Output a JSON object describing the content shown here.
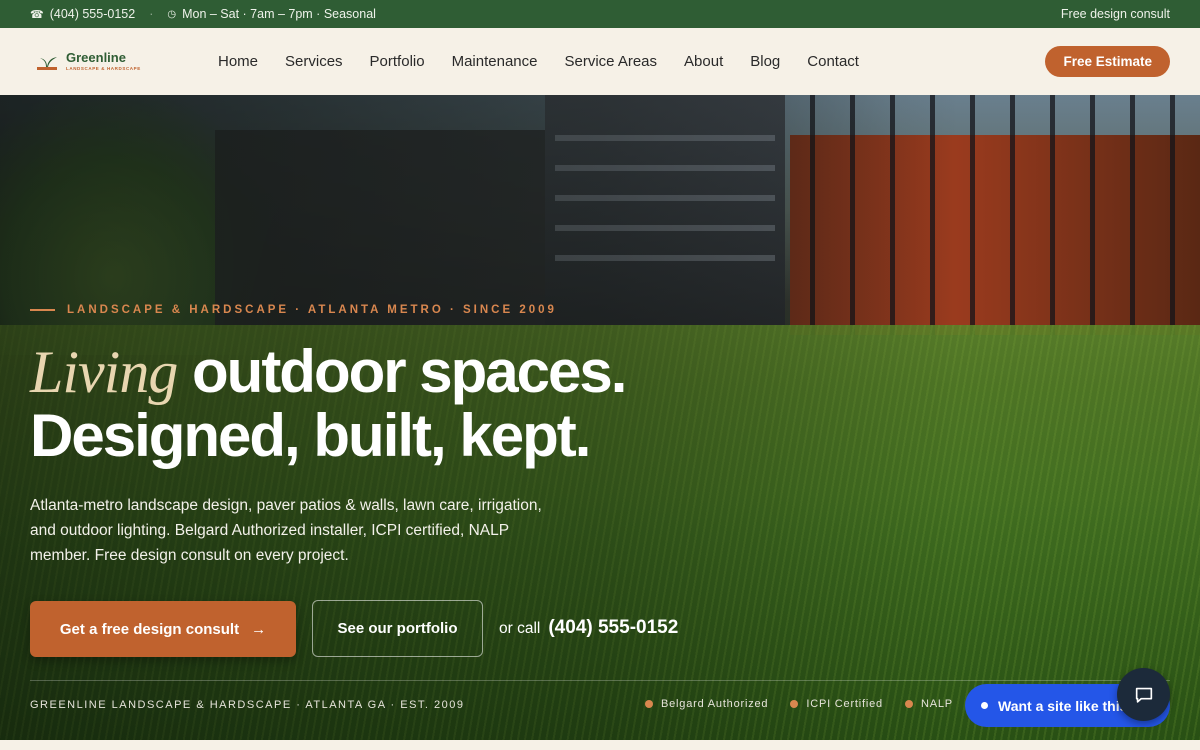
{
  "topbar": {
    "phone": "(404) 555-0152",
    "hours": "Mon – Sat · 7am – 7pm · Seasonal",
    "separator": "·",
    "right_text": "Free design consult",
    "phone_icon": "☎",
    "clock_icon": "◷"
  },
  "brand": {
    "name": "Greenline",
    "tagline": "LANDSCAPE & HARDSCAPE",
    "colors": {
      "green": "#2f5d34",
      "accent": "#c0622e",
      "cream": "#f6f1e7"
    }
  },
  "nav": {
    "items": [
      "Home",
      "Services",
      "Portfolio",
      "Maintenance",
      "Service Areas",
      "About",
      "Blog",
      "Contact"
    ],
    "cta": "Free Estimate"
  },
  "hero": {
    "eyebrow": "LANDSCAPE & HARDSCAPE · ATLANTA METRO · SINCE 2009",
    "headline_script": "Living",
    "headline_rest": "outdoor spaces.",
    "headline_line2": "Designed, built, kept.",
    "lede": "Atlanta-metro landscape design, paver patios & walls, lawn care, irrigation, and outdoor lighting. Belgard Authorized installer, ICPI certified, NALP member. Free design consult on every project.",
    "cta_primary": "Get a free design consult",
    "cta_primary_icon": "→",
    "cta_secondary": "See our portfolio",
    "call_prefix": "or call",
    "call_number": "(404) 555-0152",
    "footline": "GREENLINE LANDSCAPE & HARDSCAPE · ATLANTA GA · EST. 2009",
    "badges": [
      "Belgard Authorized",
      "ICPI Certified",
      "NALP"
    ]
  },
  "widget": {
    "pill_text": "Want a site like this?",
    "chat_icon": "chat-bubble-icon"
  }
}
